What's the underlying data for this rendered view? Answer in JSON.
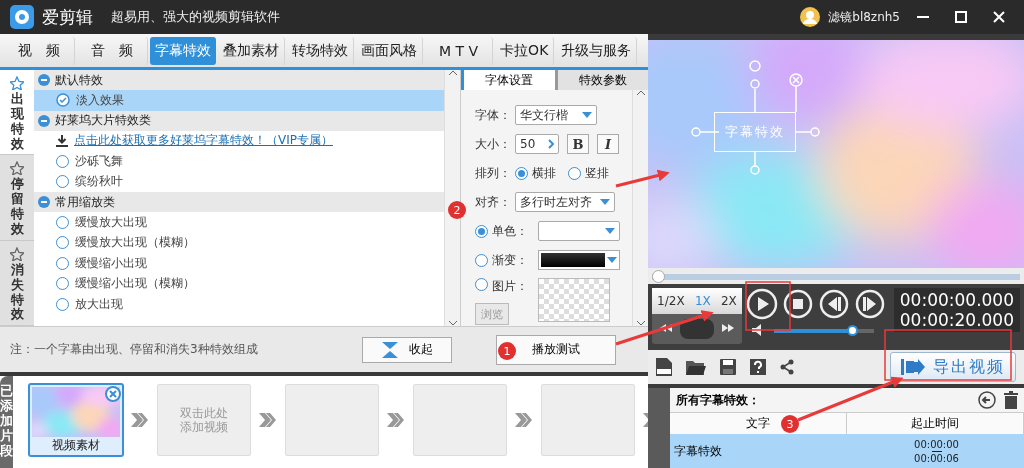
{
  "window": {
    "app_name": "爱剪辑",
    "slogan": "超易用、强大的视频剪辑软件",
    "user": "滤镜bl8znh5"
  },
  "tabs": [
    {
      "label": "视　频",
      "selected": false
    },
    {
      "label": "音　频",
      "selected": false
    },
    {
      "label": "字幕特效",
      "selected": true
    },
    {
      "label": "叠加素材",
      "selected": false
    },
    {
      "label": "转场特效",
      "selected": false
    },
    {
      "label": "画面风格",
      "selected": false
    },
    {
      "label": "M T V",
      "selected": false
    },
    {
      "label": "卡拉OK",
      "selected": false
    },
    {
      "label": "升级与服务",
      "selected": false
    }
  ],
  "side_tabs": [
    {
      "label": "出现特效",
      "selected": true
    },
    {
      "label": "停留特效",
      "selected": false
    },
    {
      "label": "消失特效",
      "selected": false
    }
  ],
  "effect_groups": [
    {
      "title": "默认特效",
      "items": [
        {
          "kind": "option",
          "label": "淡入效果",
          "selected": true
        }
      ]
    },
    {
      "title": "好莱坞大片特效类",
      "items": [
        {
          "kind": "link",
          "label": "点击此处获取更多好莱坞字幕特效！（VIP专属）"
        },
        {
          "kind": "option",
          "label": "沙砾飞舞",
          "selected": false
        },
        {
          "kind": "option",
          "label": "缤纷秋叶",
          "selected": false
        }
      ]
    },
    {
      "title": "常用缩放类",
      "items": [
        {
          "kind": "option",
          "label": "缓慢放大出现",
          "selected": false
        },
        {
          "kind": "option",
          "label": "缓慢放大出现（模糊）",
          "selected": false
        },
        {
          "kind": "option",
          "label": "缓慢缩小出现",
          "selected": false
        },
        {
          "kind": "option",
          "label": "缓慢缩小出现（模糊）",
          "selected": false
        },
        {
          "kind": "option",
          "label": "放大出现",
          "selected": false
        }
      ]
    }
  ],
  "settings": {
    "tabs": [
      {
        "label": "字体设置",
        "selected": true
      },
      {
        "label": "特效参数",
        "selected": false
      }
    ],
    "font_label": "字体：",
    "font": "华文行楷",
    "size_label": "大小：",
    "size": "50",
    "bold": "B",
    "italic": "I",
    "layout_label": "排列：",
    "layouts": [
      {
        "label": "横排",
        "selected": true
      },
      {
        "label": "竖排",
        "selected": false
      }
    ],
    "align_label": "对齐：",
    "align": "多行时左对齐",
    "fills": [
      {
        "kind": "solid",
        "label": "单色：",
        "selected": true
      },
      {
        "kind": "gradient",
        "label": "渐变：",
        "selected": false
      },
      {
        "label": "图片：",
        "selected": false
      }
    ],
    "browse": {
      "label": "浏览",
      "disabled": true
    },
    "play_test": "播放测试"
  },
  "note": "注：一个字幕由出现、停留和消失3种特效组成",
  "collapse": "收起",
  "preview": {
    "caption": "字幕特效",
    "seek": {
      "level": 0
    }
  },
  "speeds": [
    {
      "label": "1/2X",
      "selected": false
    },
    {
      "label": "1X",
      "selected": true
    },
    {
      "label": "2X",
      "selected": false
    }
  ],
  "times": [
    "00:00:00.000",
    "00:00:20.000"
  ],
  "volume": {
    "level": 0.82
  },
  "export": "导出视频",
  "subtitle_list": {
    "title": "所有字幕特效：",
    "columns": [
      "文字",
      "起止时间"
    ],
    "rows": [
      {
        "text": "字幕特效",
        "start": "00:00:00",
        "end": "00:00:06",
        "selected": true
      }
    ]
  },
  "clips_label": "已添加片段",
  "clips": [
    {
      "kind": "video",
      "label": "视频素材"
    },
    {
      "kind": "add",
      "lines": [
        "双击此处",
        "添加视频"
      ]
    },
    {
      "kind": "empty"
    },
    {
      "kind": "empty"
    },
    {
      "kind": "empty"
    }
  ],
  "annotations": [
    {
      "label": "1"
    },
    {
      "label": "2"
    },
    {
      "label": "3"
    }
  ]
}
